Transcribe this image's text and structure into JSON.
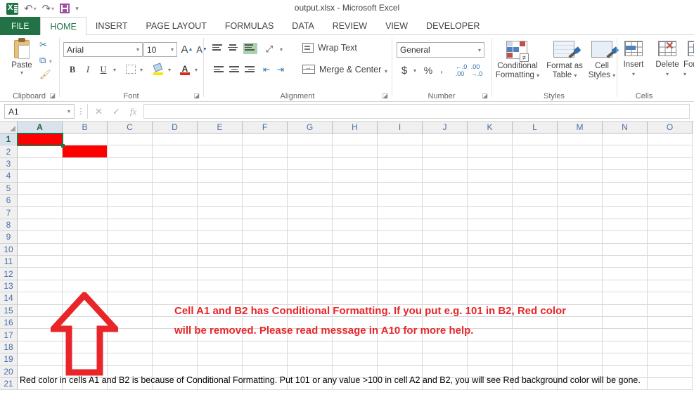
{
  "window": {
    "title": "output.xlsx - Microsoft Excel",
    "app_icon": "excel-logo-icon"
  },
  "quick_access": {
    "undo_label": "↶",
    "undo_caret": "▾",
    "redo_label": "↷",
    "redo_caret": "▾",
    "save_name": "save-icon",
    "customize_caret": "▾"
  },
  "ribbon": {
    "tabs": [
      {
        "label": "FILE",
        "active": false,
        "is_file": true
      },
      {
        "label": "HOME",
        "active": true,
        "is_file": false
      },
      {
        "label": "INSERT",
        "active": false,
        "is_file": false
      },
      {
        "label": "PAGE LAYOUT",
        "active": false,
        "is_file": false
      },
      {
        "label": "FORMULAS",
        "active": false,
        "is_file": false
      },
      {
        "label": "DATA",
        "active": false,
        "is_file": false
      },
      {
        "label": "REVIEW",
        "active": false,
        "is_file": false
      },
      {
        "label": "VIEW",
        "active": false,
        "is_file": false
      },
      {
        "label": "DEVELOPER",
        "active": false,
        "is_file": false
      }
    ],
    "clipboard": {
      "group_label": "Clipboard",
      "paste_label": "Paste",
      "paste_caret": "▾",
      "cut_icon": "scissors-icon",
      "copy_icon": "copy-icon",
      "copy_caret": "▾",
      "format_painter_icon": "format-painter-icon",
      "dialog_launcher": "◪"
    },
    "font": {
      "group_label": "Font",
      "font_name": "Arial",
      "font_size": "10",
      "caret": "▾",
      "grow_font": "A",
      "shrink_font": "A",
      "bold": "B",
      "italic": "I",
      "underline": "U",
      "underline_caret": "▾",
      "borders_caret": "▾",
      "fill_color": "fill-color-icon",
      "fill_caret": "▾",
      "font_color": "A",
      "font_caret": "▾",
      "dialog_launcher": "◪"
    },
    "alignment": {
      "group_label": "Alignment",
      "top_align": "top-align-icon",
      "middle_align": "middle-align-icon",
      "bottom_align": "bottom-align-icon",
      "orientation": "orientation-icon",
      "orientation_caret": "▾",
      "align_left": "align-left-icon",
      "align_center": "align-center-icon",
      "align_right": "align-right-icon",
      "decrease_indent": "⇤",
      "increase_indent": "⇥",
      "wrap_text_label": "Wrap Text",
      "merge_center_label": "Merge & Center",
      "merge_caret": "▾",
      "dialog_launcher": "◪"
    },
    "number": {
      "group_label": "Number",
      "format_value": "General",
      "caret": "▾",
      "currency": "$",
      "currency_caret": "▾",
      "percent": "%",
      "comma": ",",
      "increase_decimal": ".00",
      "decrease_decimal": ".00",
      "dialog_launcher": "◪"
    },
    "styles": {
      "group_label": "Styles",
      "conditional_formatting_line1": "Conditional",
      "conditional_formatting_line2": "Formatting",
      "conditional_caret": "▾",
      "format_as_table_line1": "Format as",
      "format_as_table_line2": "Table",
      "table_caret": "▾",
      "cell_styles_line1": "Cell",
      "cell_styles_line2": "Styles",
      "cell_styles_caret": "▾"
    },
    "cells": {
      "group_label": "Cells",
      "insert_label": "Insert",
      "insert_caret": "▾",
      "delete_label": "Delete",
      "delete_caret": "▾",
      "format_label": "For",
      "format_caret": "▾"
    }
  },
  "formula_bar": {
    "name_box_value": "A1",
    "name_box_caret": "▾",
    "cancel_icon": "✕",
    "enter_icon": "✓",
    "function_icon": "fx",
    "formula_value": ""
  },
  "grid": {
    "columns": [
      "A",
      "B",
      "C",
      "D",
      "E",
      "F",
      "G",
      "H",
      "I",
      "J",
      "K",
      "L",
      "M",
      "N",
      "O"
    ],
    "selected_column": "A",
    "rows": [
      1,
      2,
      3,
      4,
      5,
      6,
      7,
      8,
      9,
      10,
      11,
      12,
      13,
      14,
      15,
      16,
      17,
      18,
      19,
      20,
      21
    ],
    "selected_row": 1,
    "active_cell": "A1",
    "filled_cells": [
      {
        "ref": "A1",
        "color": "#ff0000",
        "value": ""
      },
      {
        "ref": "B2",
        "color": "#ff0000",
        "value": ""
      }
    ],
    "message_red_line1": "Cell A1 and B2 has Conditional Formatting. If you put e.g. 101 in B2, Red color",
    "message_red_line2": "will be removed. Please read message in A10 for more help.",
    "message_red_color": "#e8262a",
    "cell_a10_value": "Red color in cells A1 and B2 is because of Conditional Formatting. Put 101 or any value >100 in cell A2 and B2, you will see Red background color will be gone.",
    "arrow_shape": "up-arrow-shape",
    "arrow_color": "#e8262a"
  }
}
